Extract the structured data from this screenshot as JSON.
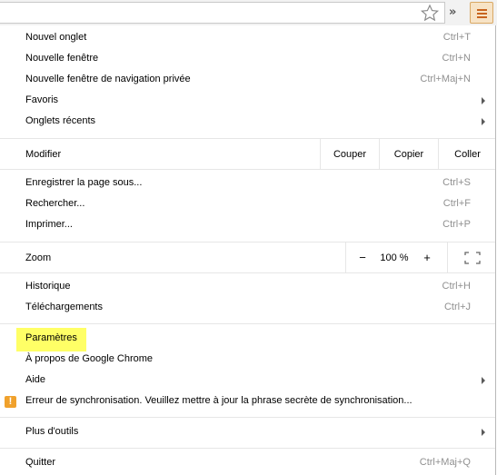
{
  "toolbar": {
    "overflow_label": "»"
  },
  "menu": {
    "group1": [
      {
        "label": "Nouvel onglet",
        "shortcut": "Ctrl+T"
      },
      {
        "label": "Nouvelle fenêtre",
        "shortcut": "Ctrl+N"
      },
      {
        "label": "Nouvelle fenêtre de navigation privée",
        "shortcut": "Ctrl+Maj+N"
      },
      {
        "label": "Favoris"
      },
      {
        "label": "Onglets récents"
      }
    ],
    "edit": {
      "label": "Modifier",
      "cut": "Couper",
      "copy": "Copier",
      "paste": "Coller"
    },
    "group2": [
      {
        "label": "Enregistrer la page sous...",
        "shortcut": "Ctrl+S"
      },
      {
        "label": "Rechercher...",
        "shortcut": "Ctrl+F"
      },
      {
        "label": "Imprimer...",
        "shortcut": "Ctrl+P"
      }
    ],
    "zoom": {
      "label": "Zoom",
      "minus": "−",
      "value": "100 %",
      "plus": "+"
    },
    "group3": [
      {
        "label": "Historique",
        "shortcut": "Ctrl+H"
      },
      {
        "label": "Téléchargements",
        "shortcut": "Ctrl+J"
      }
    ],
    "group4": [
      {
        "label": "Paramètres"
      },
      {
        "label": "À propos de Google Chrome"
      },
      {
        "label": "Aide"
      },
      {
        "label": "Erreur de synchronisation. Veuillez mettre à jour la phrase secrète de synchronisation..."
      }
    ],
    "more_tools": "Plus d'outils",
    "quit": {
      "label": "Quitter",
      "shortcut": "Ctrl+Maj+Q"
    }
  },
  "colors": {
    "highlight": "#ffff66",
    "warning": "#f0a12c",
    "menu_button": "#f7e3c6"
  },
  "icons": [
    "star-icon",
    "chevron-double-icon",
    "hamburger-menu-icon",
    "fullscreen-icon",
    "warning-icon",
    "submenu-arrow-icon"
  ]
}
